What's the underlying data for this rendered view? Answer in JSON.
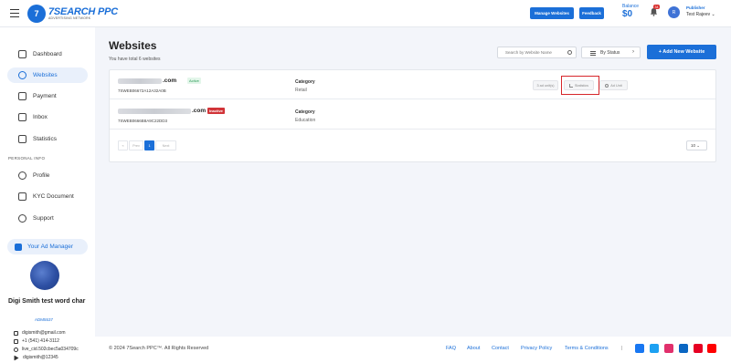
{
  "header": {
    "logo_mark": "7",
    "logo_title": "7SEARCH PPC",
    "logo_sub": "ADVERTISING NETWORK",
    "manage_websites": "Manage Websites",
    "feedback": "Feedback",
    "balance_label": "Balance",
    "balance_value": "$0",
    "notifications_count": "34",
    "avatar_initial": "R",
    "user_role": "Publisher",
    "user_name": "Test Rajeev ⌄"
  },
  "sidebar": {
    "items": [
      {
        "label": "Dashboard",
        "active": false
      },
      {
        "label": "Websites",
        "active": true
      },
      {
        "label": "Payment",
        "active": false
      },
      {
        "label": "Inbox",
        "active": false
      },
      {
        "label": "Statistics",
        "active": false
      }
    ],
    "personal_info_label": "PERSONAL INFO",
    "personal_items": [
      {
        "label": "Profile"
      },
      {
        "label": "KYC Document"
      },
      {
        "label": "Support"
      }
    ],
    "ad_manager_label": "Your Ad Manager",
    "manager_name": "Digi Smith test word char",
    "manager_id": "ADM5537",
    "contacts": [
      "digismith@gmail.com",
      "+1 (541) 414-3112",
      "live_cid.502cbec5a034709c",
      "digismith@12345"
    ]
  },
  "main": {
    "title": "Websites",
    "subtitle": "You have total 6 websites",
    "search_placeholder": "Search by Website Name",
    "status_filter": "By Status",
    "status_chevron": "›",
    "add_button": "+   Add New Website",
    "websites": [
      {
        "domain_suffix": ".com",
        "status": "Active",
        "id": "7SWEB06672A12A32A0B",
        "category_label": "Category",
        "category": "Retail",
        "actions": [
          "3 ad unit(s)",
          "Statistics",
          "Ad Unit"
        ]
      },
      {
        "domain_suffix": ".com",
        "status": "Inactive",
        "id": "7SWEB0666B8A9C22DD3",
        "category_label": "Category",
        "category": "Education"
      }
    ],
    "pagination": {
      "prev_first": "«",
      "prev": "Prev",
      "current": "1",
      "next": "Next",
      "per_page": "10 ⌄"
    }
  },
  "footer": {
    "copyright": "© 2024 7Search PPC™. All Rights Reserved",
    "links": [
      "FAQ",
      "About",
      "Contact",
      "Privacy Policy",
      "Terms & Conditions"
    ],
    "separator": "|",
    "social": [
      {
        "name": "facebook-icon",
        "color": "#1877f2"
      },
      {
        "name": "twitter-icon",
        "color": "#1da1f2"
      },
      {
        "name": "instagram-icon",
        "color": "#e1306c"
      },
      {
        "name": "linkedin-icon",
        "color": "#0a66c2"
      },
      {
        "name": "pinterest-icon",
        "color": "#e60023"
      },
      {
        "name": "youtube-icon",
        "color": "#ff0000"
      }
    ]
  }
}
